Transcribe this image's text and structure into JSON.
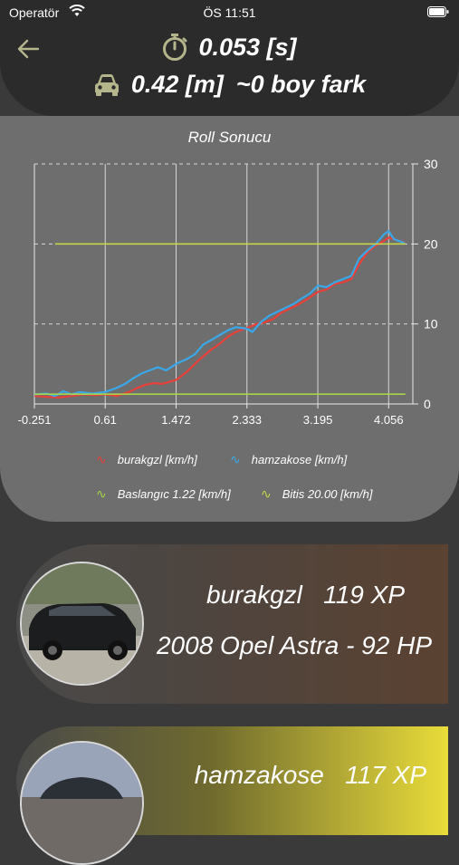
{
  "status": {
    "carrier": "Operatör",
    "time": "ÖS 11:51"
  },
  "header": {
    "elapsed": "0.053 [s]",
    "distance": "0.42 [m]",
    "length_diff": "~0 boy fark"
  },
  "chart_data": {
    "type": "line",
    "title": "Roll Sonucu",
    "x_ticks": [
      "-0.251",
      "0.61",
      "1.472",
      "2.333",
      "3.195",
      "4.056"
    ],
    "x_tick_values": [
      -0.251,
      0.61,
      1.472,
      2.333,
      3.195,
      4.056
    ],
    "xlim": [
      -0.251,
      4.35
    ],
    "ylim": [
      0,
      30
    ],
    "y_ticks": [
      "0",
      "10",
      "20",
      "30"
    ],
    "grid": true,
    "legend_position": "bottom",
    "series": [
      {
        "name": "burakgzl [km/h]",
        "color": "#e8403a",
        "x": [
          -0.25,
          -0.1,
          0.05,
          0.2,
          0.35,
          0.5,
          0.61,
          0.75,
          0.9,
          1.0,
          1.1,
          1.2,
          1.3,
          1.4,
          1.472,
          1.6,
          1.75,
          1.9,
          2.0,
          2.1,
          2.2,
          2.333,
          2.45,
          2.55,
          2.65,
          2.75,
          2.85,
          2.95,
          3.05,
          3.195,
          3.3,
          3.4,
          3.5,
          3.6,
          3.7,
          3.8,
          3.9,
          4.0,
          4.056,
          4.12,
          4.2,
          4.25
        ],
        "y": [
          1.0,
          0.9,
          0.8,
          1.0,
          1.2,
          1.1,
          1.2,
          1.0,
          1.5,
          2.0,
          2.4,
          2.6,
          2.5,
          2.8,
          3.0,
          4.0,
          5.5,
          6.8,
          7.5,
          8.4,
          9.0,
          9.5,
          10.0,
          10.2,
          10.6,
          11.4,
          11.9,
          12.4,
          13.0,
          14.0,
          14.3,
          15.0,
          15.2,
          15.6,
          17.5,
          19.0,
          19.8,
          20.4,
          20.8,
          20.6,
          20.3,
          20.2
        ]
      },
      {
        "name": "hamzakose [km/h]",
        "color": "#3aa8e8",
        "x": [
          -0.25,
          -0.1,
          0.0,
          0.1,
          0.2,
          0.3,
          0.45,
          0.61,
          0.75,
          0.85,
          0.95,
          1.05,
          1.15,
          1.25,
          1.35,
          1.472,
          1.6,
          1.7,
          1.8,
          1.9,
          2.0,
          2.1,
          2.2,
          2.333,
          2.4,
          2.5,
          2.6,
          2.7,
          2.8,
          2.9,
          3.0,
          3.1,
          3.195,
          3.3,
          3.4,
          3.5,
          3.6,
          3.7,
          3.8,
          3.9,
          4.0,
          4.056,
          4.12,
          4.2,
          4.25
        ],
        "y": [
          1.2,
          1.3,
          1.0,
          1.6,
          1.2,
          1.5,
          1.3,
          1.5,
          2.0,
          2.5,
          3.2,
          3.8,
          4.2,
          4.6,
          4.2,
          5.0,
          5.6,
          6.2,
          7.4,
          8.0,
          8.6,
          9.2,
          9.6,
          9.4,
          9.0,
          10.2,
          11.0,
          11.5,
          12.0,
          12.5,
          13.2,
          13.8,
          14.8,
          14.6,
          15.2,
          15.6,
          16.0,
          18.2,
          19.2,
          20.0,
          21.2,
          21.6,
          20.6,
          20.3,
          20.1
        ]
      },
      {
        "name": "Baslangıc 1.22 [km/h]",
        "color": "#a8d44a",
        "x": [
          -0.25,
          4.26
        ],
        "y": [
          1.22,
          1.22
        ]
      },
      {
        "name": "Bitis 20.00 [km/h]",
        "color": "#c7d44a",
        "x": [
          0.0,
          4.26
        ],
        "y": [
          20.0,
          20.0
        ]
      }
    ]
  },
  "legend_symbol": "∿",
  "cards": [
    {
      "name": "burakgzl",
      "xp": "119 XP",
      "car": "2008 Opel Astra - 92 HP"
    },
    {
      "name": "hamzakose",
      "xp": "117 XP"
    }
  ],
  "icons": {
    "back": "arrow-left-icon",
    "stopwatch": "stopwatch-icon",
    "car": "car-icon",
    "wifi": "wifi-icon",
    "battery": "battery-icon"
  },
  "colors": {
    "accent": "#b5b58c",
    "header_bg": "#2b2b2b",
    "chart_bg": "#6e6e6e"
  }
}
